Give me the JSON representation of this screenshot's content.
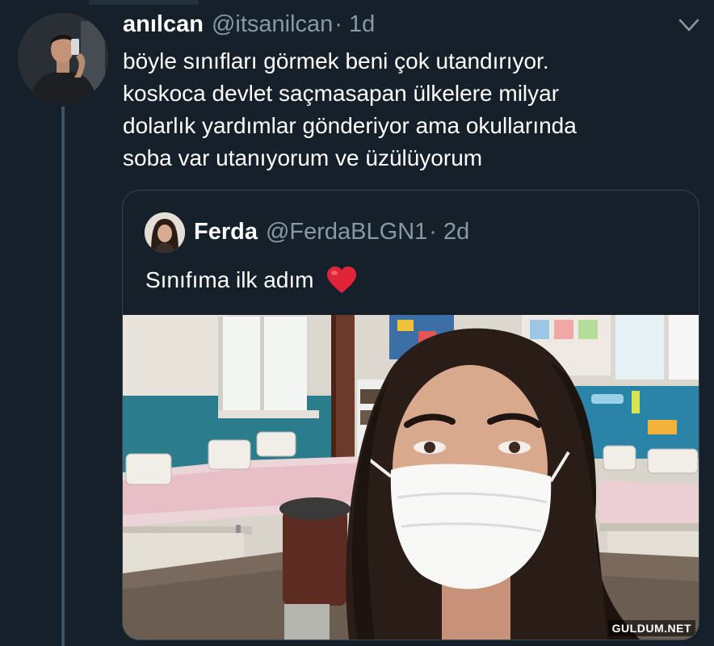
{
  "tweet": {
    "name": "anılcan",
    "handle": "@itsanilcan",
    "time": "· 1d",
    "text": "böyle sınıfları görmek beni çok utandırıyor.\nkoskoca devlet saçmasapan ülkelere milyar\ndolarlık yardımlar gönderiyor ama okullarında\nsoba var utanıyorum ve üzülüyorum",
    "avatar_icon": "profile-photo",
    "menu_icon": "chevron-down-icon"
  },
  "quoted_tweet": {
    "name": "Ferda",
    "handle": "@FerdaBLGN1",
    "time": "· 2d",
    "text": "Sınıfıma ilk adım",
    "emoji": "❤️",
    "avatar_icon": "profile-photo"
  },
  "watermark": "GULDUM.NET",
  "colors": {
    "background": "#15202b",
    "secondary_text": "#8899a6",
    "border": "#38444d",
    "thread_line": "#3d5466"
  }
}
